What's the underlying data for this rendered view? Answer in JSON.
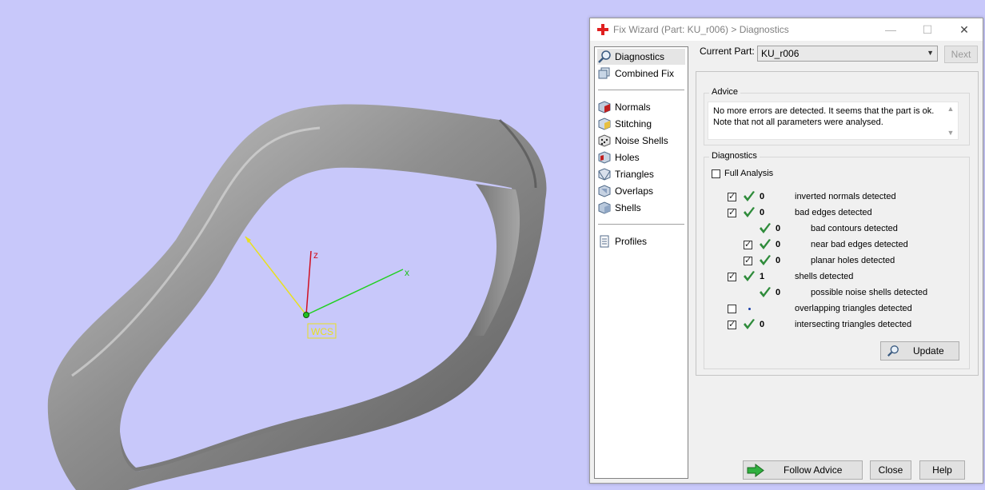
{
  "viewport": {
    "axis_z": "z",
    "axis_x": "x",
    "wcs_label": "WCS"
  },
  "dialog": {
    "title": "Fix Wizard (Part: KU_r006) > Diagnostics",
    "window_controls": {
      "minimize": "—",
      "maximize": "☐",
      "close": "✕"
    },
    "nav": {
      "diagnostics": "Diagnostics",
      "combined_fix": "Combined Fix",
      "normals": "Normals",
      "stitching": "Stitching",
      "noise_shells": "Noise Shells",
      "holes": "Holes",
      "triangles": "Triangles",
      "overlaps": "Overlaps",
      "shells": "Shells",
      "profiles": "Profiles"
    },
    "current_part_label": "Current Part:",
    "current_part_value": "KU_r006",
    "next_button": "Next",
    "advice": {
      "title": "Advice",
      "line1": "No more errors are detected. It seems that the part is ok.",
      "line2": "Note that not all parameters were analysed."
    },
    "diagnostics": {
      "title": "Diagnostics",
      "full_analysis": "Full Analysis",
      "rows": [
        {
          "checkbox": true,
          "checked": true,
          "ok": true,
          "count": "0",
          "label": "inverted normals detected",
          "indent": 0
        },
        {
          "checkbox": true,
          "checked": true,
          "ok": true,
          "count": "0",
          "label": "bad edges detected",
          "indent": 0
        },
        {
          "checkbox": false,
          "checked": false,
          "ok": true,
          "count": "0",
          "label": "bad contours detected",
          "indent": 1
        },
        {
          "checkbox": true,
          "checked": true,
          "ok": true,
          "count": "0",
          "label": "near bad edges detected",
          "indent": 1
        },
        {
          "checkbox": true,
          "checked": true,
          "ok": true,
          "count": "0",
          "label": "planar holes detected",
          "indent": 1
        },
        {
          "checkbox": true,
          "checked": true,
          "ok": true,
          "count": "1",
          "label": "shells detected",
          "indent": 0
        },
        {
          "checkbox": false,
          "checked": false,
          "ok": true,
          "count": "0",
          "label": "possible noise shells detected",
          "indent": 1
        },
        {
          "checkbox": true,
          "checked": false,
          "ok": false,
          "count": "",
          "label": "overlapping triangles detected",
          "indent": 0
        },
        {
          "checkbox": true,
          "checked": true,
          "ok": true,
          "count": "0",
          "label": "intersecting triangles detected",
          "indent": 0
        }
      ],
      "update_button": "Update"
    },
    "footer": {
      "follow_advice": "Follow Advice",
      "close": "Close",
      "help": "Help"
    }
  },
  "colors": {
    "viewport_bg": "#c8c8fa",
    "check_green": "#2e8b3a",
    "axis_red": "#d01020",
    "axis_green": "#20d020",
    "axis_yellow": "#e8e020"
  }
}
